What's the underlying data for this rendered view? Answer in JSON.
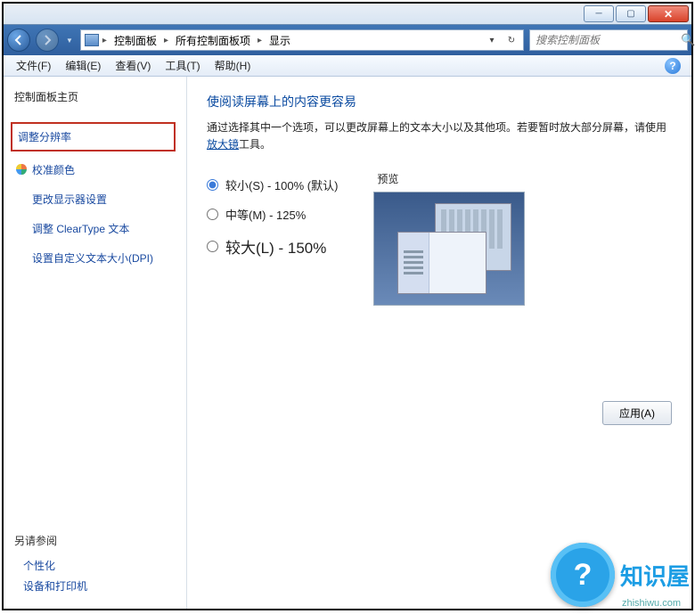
{
  "breadcrumb": {
    "item1": "控制面板",
    "item2": "所有控制面板项",
    "item3": "显示"
  },
  "search": {
    "placeholder": "搜索控制面板"
  },
  "menu": {
    "file": "文件(F)",
    "edit": "编辑(E)",
    "view": "查看(V)",
    "tools": "工具(T)",
    "help": "帮助(H)"
  },
  "sidebar": {
    "home": "控制面板主页",
    "links": [
      "调整分辨率",
      "校准颜色",
      "更改显示器设置",
      "调整 ClearType 文本",
      "设置自定义文本大小(DPI)"
    ],
    "see_also_hdr": "另请参阅",
    "see_also": [
      "个性化",
      "设备和打印机"
    ]
  },
  "main": {
    "title": "使阅读屏幕上的内容更容易",
    "intro_a": "通过选择其中一个选项，可以更改屏幕上的文本大小以及其他项。若要暂时放大部分屏幕，请使用",
    "intro_link": "放大镜",
    "intro_b": "工具。",
    "options": [
      {
        "label": "较小(S) - 100% (默认)",
        "checked": true
      },
      {
        "label": "中等(M) - 125%",
        "checked": false
      },
      {
        "label": "较大(L) - 150%",
        "checked": false
      }
    ],
    "preview_label": "预览",
    "apply": "应用(A)"
  },
  "badge": {
    "q": "?",
    "name": "知识屋",
    "url": "zhishiwu.com"
  }
}
